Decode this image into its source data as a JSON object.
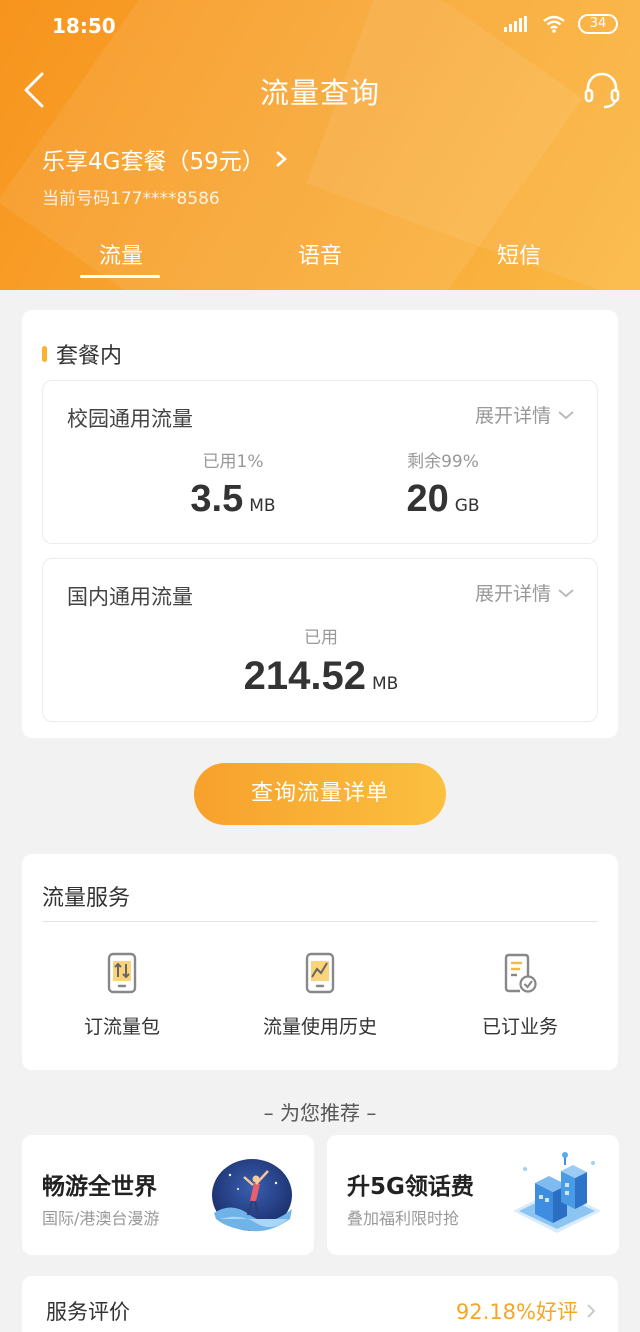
{
  "status_bar": {
    "time": "18:50",
    "battery": "34"
  },
  "header": {
    "title": "流量查询",
    "plan_name": "乐享4G套餐（59元）",
    "phone_number": "当前号码177****8586"
  },
  "tabs": [
    {
      "label": "流量",
      "active": true
    },
    {
      "label": "语音",
      "active": false
    },
    {
      "label": "短信",
      "active": false
    }
  ],
  "package": {
    "section_title": "套餐内",
    "campus": {
      "title": "校园通用流量",
      "expand_label": "展开详情",
      "used_label": "已用1%",
      "used_value": "3.5",
      "used_unit": "MB",
      "remain_label": "剩余99%",
      "remain_value": "20",
      "remain_unit": "GB"
    },
    "domestic": {
      "title": "国内通用流量",
      "expand_label": "展开详情",
      "used_label": "已用",
      "used_value": "214.52",
      "used_unit": "MB"
    }
  },
  "query_button": "查询流量详单",
  "services": {
    "title": "流量服务",
    "items": [
      {
        "label": "订流量包",
        "icon": "phone-transfer-icon"
      },
      {
        "label": "流量使用历史",
        "icon": "phone-chart-icon"
      },
      {
        "label": "已订业务",
        "icon": "document-check-icon"
      }
    ]
  },
  "recommend": {
    "title": "– 为您推荐 –",
    "items": [
      {
        "title": "畅游全世界",
        "subtitle": "国际/港澳台漫游"
      },
      {
        "title": "升5G领话费",
        "subtitle": "叠加福利限时抢"
      }
    ]
  },
  "rating": {
    "label": "服务评价",
    "value": "92.18%好评"
  },
  "colors": {
    "accent": "#f7941d",
    "highlight": "#f6a623"
  }
}
